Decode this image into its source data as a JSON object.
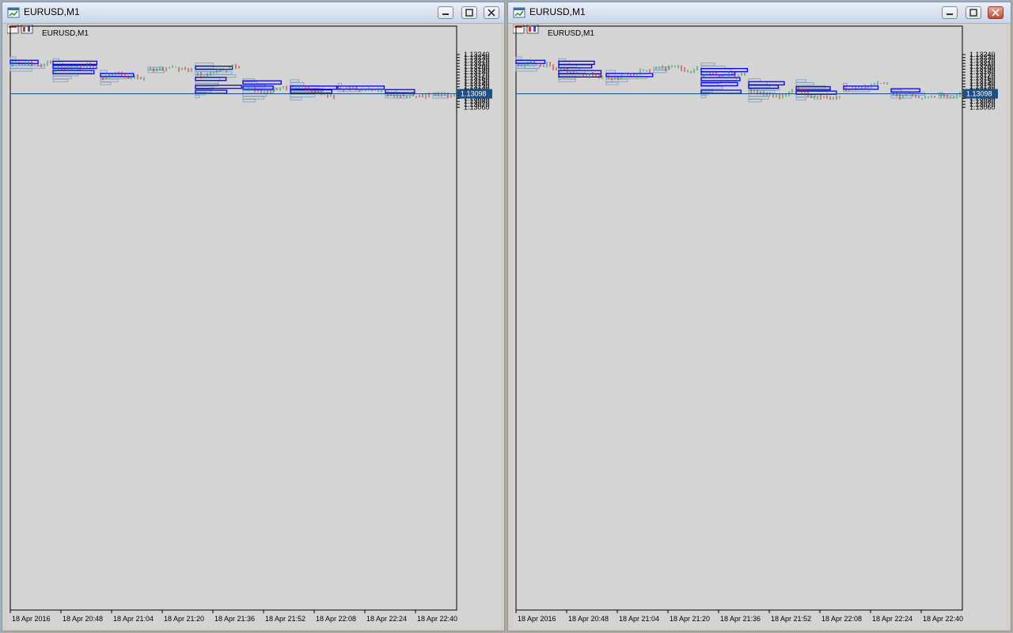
{
  "windows": [
    {
      "id": "left",
      "title": "EURUSD,M1",
      "symbol_label": "EURUSD,M1",
      "y_ticks": [
        "1.13240",
        "1.13230",
        "1.13220",
        "1.13210",
        "1.13200",
        "1.13190",
        "1.13180",
        "1.13170",
        "1.13160",
        "1.13150",
        "1.13140",
        "1.13130",
        "1.13120",
        "1.13110",
        "1.13100",
        "1.13090",
        "1.13080",
        "1.13070",
        "1.13060"
      ],
      "x_ticks": [
        "18 Apr 2016",
        "18 Apr 20:48",
        "18 Apr 21:04",
        "18 Apr 21:20",
        "18 Apr 21:36",
        "18 Apr 21:52",
        "18 Apr 22:08",
        "18 Apr 22:24",
        "18 Apr 22:40"
      ],
      "current_price": "1.13098",
      "chart_data": {
        "type": "candlestick",
        "y_range": [
          1.1305,
          1.1325
        ],
        "profiles": [
          {
            "low": 1.13185,
            "high": 1.1323,
            "poc": 1.13215,
            "width": 52
          },
          {
            "low": 1.13155,
            "high": 1.13225,
            "poc": 1.1321,
            "width": 36
          },
          {
            "low": 1.13155,
            "high": 1.13225,
            "poc": 1.13197,
            "width": 44
          },
          {
            "low": 1.13155,
            "high": 1.13225,
            "poc": 1.1318,
            "width": 60
          },
          {
            "low": 1.13145,
            "high": 1.13185,
            "poc": 1.1317,
            "width": 60
          },
          {
            "low": 1.13175,
            "high": 1.132,
            "poc": 1.13195,
            "width": 80
          },
          {
            "low": 1.131,
            "high": 1.1321,
            "poc": 1.13195,
            "width": 20
          },
          {
            "low": 1.131,
            "high": 1.13165,
            "poc": 1.13157,
            "width": 44
          },
          {
            "low": 1.131,
            "high": 1.13165,
            "poc": 1.1313,
            "width": 60
          },
          {
            "low": 1.131,
            "high": 1.13165,
            "poc": 1.13113,
            "width": 48
          },
          {
            "low": 1.1308,
            "high": 1.13155,
            "poc": 1.13145,
            "width": 60
          },
          {
            "low": 1.1308,
            "high": 1.13155,
            "poc": 1.13127,
            "width": 56
          },
          {
            "low": 1.13095,
            "high": 1.13155,
            "poc": 1.13127,
            "width": 60
          },
          {
            "low": 1.13095,
            "high": 1.13155,
            "poc": 1.13114,
            "width": 56
          },
          {
            "low": 1.13118,
            "high": 1.13142,
            "poc": 1.13127,
            "width": 120
          },
          {
            "low": 1.13095,
            "high": 1.1312,
            "poc": 1.13115,
            "width": 60
          },
          {
            "low": 1.13093,
            "high": 1.1311,
            "poc": 1.131,
            "width": 30
          }
        ]
      }
    },
    {
      "id": "right",
      "title": "EURUSD,M1",
      "symbol_label": "EURUSD,M1",
      "y_ticks": [
        "1.13240",
        "1.13230",
        "1.13220",
        "1.13210",
        "1.13200",
        "1.13190",
        "1.13180",
        "1.13170",
        "1.13160",
        "1.13150",
        "1.13140",
        "1.13130",
        "1.13120",
        "1.13110",
        "1.13100",
        "1.13090",
        "1.13080",
        "1.13070",
        "1.13060"
      ],
      "x_ticks": [
        "18 Apr 2016",
        "18 Apr 20:48",
        "18 Apr 21:04",
        "18 Apr 21:20",
        "18 Apr 21:36",
        "18 Apr 21:52",
        "18 Apr 22:08",
        "18 Apr 22:24",
        "18 Apr 22:40"
      ],
      "current_price": "1.13098",
      "chart_data": {
        "type": "candlestick",
        "y_range": [
          1.1305,
          1.1325
        ],
        "profiles": []
      }
    }
  ],
  "colors": {
    "background": "#d4d4d4",
    "profile": "#7a9cc0",
    "poc": "#0000ff",
    "bull": "#1a9a3a",
    "bear": "#cc2020",
    "price_line": "#1c4f86",
    "price_label_bg": "#1c4f86",
    "axis": "#000000"
  },
  "icons": {
    "title": "chart-window-icon",
    "minimize": "minimize-icon",
    "maximize": "maximize-icon",
    "close": "close-icon"
  }
}
